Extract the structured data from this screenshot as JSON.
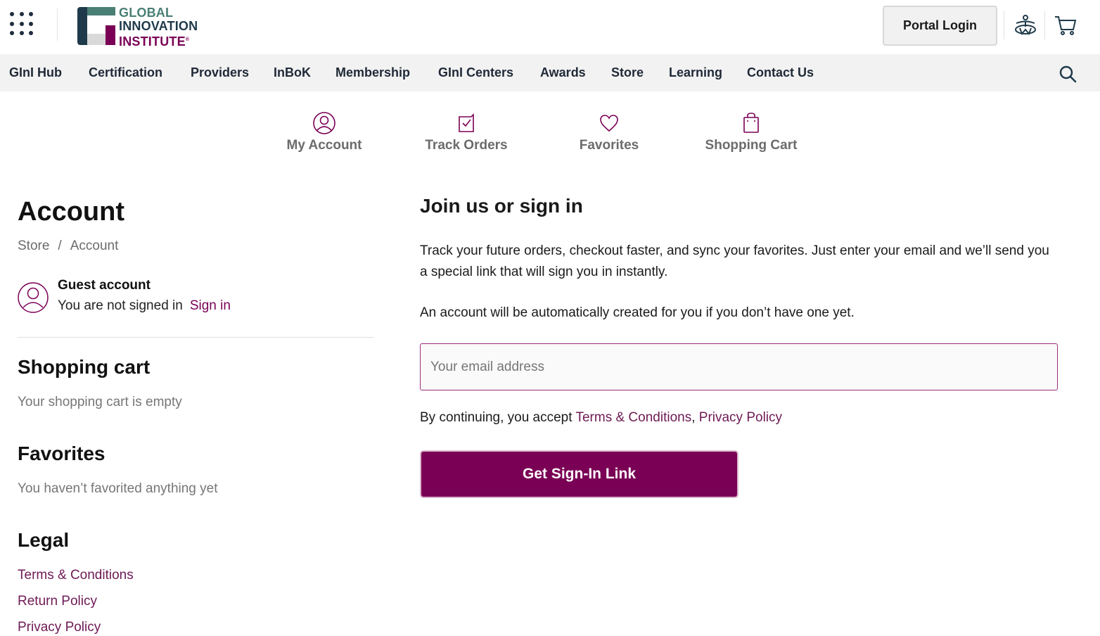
{
  "header": {
    "logo": {
      "line1": "GLOBAL",
      "line2": "INNOVATION",
      "line3": "INSTITUTE",
      "mark": "®"
    },
    "portal_login": "Portal Login",
    "icons": [
      "apps-grid-icon",
      "accessibility-icon",
      "cart-icon"
    ]
  },
  "nav": {
    "items": [
      "GInI Hub",
      "Certification",
      "Providers",
      "InBoK",
      "Membership",
      "GInI Centers",
      "Awards",
      "Store",
      "Learning",
      "Contact Us"
    ],
    "search_icon": "search-icon"
  },
  "subnav": {
    "items": [
      {
        "label": "My Account",
        "icon": "user-circle-icon"
      },
      {
        "label": "Track Orders",
        "icon": "order-check-icon"
      },
      {
        "label": "Favorites",
        "icon": "heart-icon"
      },
      {
        "label": "Shopping Cart",
        "icon": "shopping-bag-icon"
      }
    ]
  },
  "account": {
    "title": "Account",
    "breadcrumb": [
      "Store",
      "/",
      "Account"
    ],
    "guest_title": "Guest account",
    "guest_status": "You are not signed in",
    "sign_in": "Sign in",
    "shopping_cart_title": "Shopping cart",
    "shopping_cart_text": "Your shopping cart is empty",
    "favorites_title": "Favorites",
    "favorites_text": "You haven’t favorited anything yet",
    "legal_title": "Legal",
    "legal_links": [
      "Terms & Conditions",
      "Return Policy",
      "Privacy Policy"
    ]
  },
  "signin": {
    "title": "Join us or sign in",
    "para1": "Track your future orders, checkout faster, and sync your favorites. Just enter your email and we’ll send you a special link that will sign you in instantly.",
    "para2": "An account will be automatically created for you if you don’t have one yet.",
    "email_placeholder": "Your email address",
    "email_value": "",
    "consent_prefix": "By continuing, you accept ",
    "terms": "Terms & Conditions",
    "comma": ",",
    "privacy": "Privacy Policy",
    "cta": "Get Sign-In Link"
  },
  "colors": {
    "brand": "#7a0055",
    "teal": "#4a7f75",
    "navy": "#1f3a4a",
    "nav_bg": "#f2f2f2"
  }
}
